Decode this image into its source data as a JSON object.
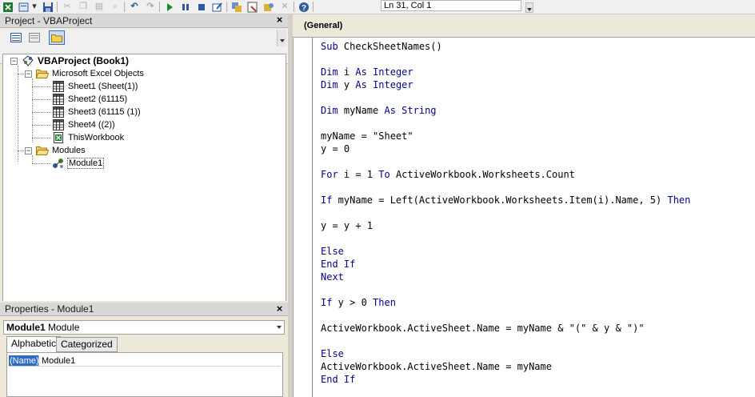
{
  "toolbar": {
    "position_text": "Ln 31, Col 1",
    "icons": [
      "excel-icon",
      "insert-module-icon",
      "save-icon",
      "cut-icon",
      "copy-icon",
      "paste-icon",
      "find-icon",
      "undo-icon",
      "redo-icon",
      "run-icon",
      "break-icon",
      "reset-icon",
      "design-mode-icon",
      "project-explorer-icon",
      "properties-icon",
      "object-browser-icon",
      "toolbox-icon",
      "help-icon"
    ]
  },
  "project": {
    "title": "Project - VBAProject",
    "close": "×",
    "tree": {
      "root": "VBAProject (Book1)",
      "excel_objects_folder": "Microsoft Excel Objects",
      "sheets": [
        "Sheet1 (Sheet(1))",
        "Sheet2 (61115)",
        "Sheet3 (61115 (1))",
        "Sheet4 ((2))"
      ],
      "workbook": "ThisWorkbook",
      "modules_folder": "Modules",
      "module": "Module1"
    }
  },
  "properties": {
    "title": "Properties - Module1",
    "close": "×",
    "object_name": "Module1",
    "object_type": "Module",
    "tabs": [
      "Alphabetic",
      "Categorized"
    ],
    "rows": [
      {
        "name": "(Name)",
        "value": "Module1"
      }
    ]
  },
  "code": {
    "object_combo": "(General)",
    "lines": [
      "Sub CheckSheetNames()",
      "",
      "Dim i As Integer",
      "Dim y As Integer",
      "",
      "Dim myName As String",
      "",
      "myName = \"Sheet\"",
      "y = 0",
      "",
      "For i = 1 To ActiveWorkbook.Worksheets.Count",
      "",
      "If myName = Left(ActiveWorkbook.Worksheets.Item(i).Name, 5) Then",
      "",
      "y = y + 1",
      "",
      "Else",
      "End If",
      "Next",
      "",
      "If y > 0 Then",
      "",
      "ActiveWorkbook.ActiveSheet.Name = myName & \"(\" & y & \")\"",
      "",
      "Else",
      "ActiveWorkbook.ActiveSheet.Name = myName",
      "End If"
    ]
  }
}
